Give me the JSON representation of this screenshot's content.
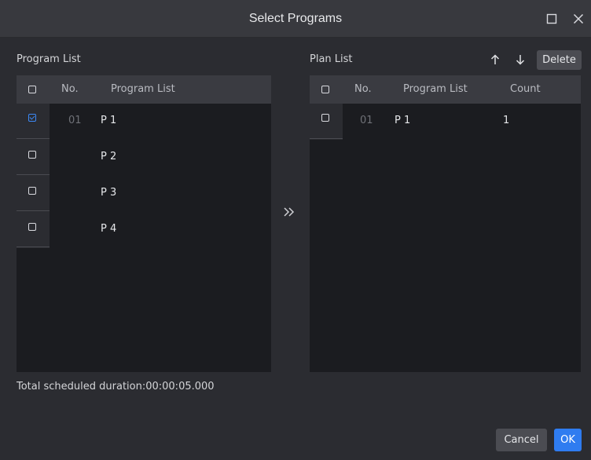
{
  "window": {
    "title": "Select Programs",
    "maximize_icon": "maximize-icon",
    "close_icon": "close-icon"
  },
  "program_list": {
    "label": "Program List",
    "columns": [
      "No.",
      "Program List"
    ],
    "rows": [
      {
        "no": "01",
        "name": "P 1",
        "checked": true
      },
      {
        "no": "",
        "name": "P 2",
        "checked": false
      },
      {
        "no": "",
        "name": "P 3",
        "checked": false
      },
      {
        "no": "",
        "name": "P 4",
        "checked": false
      }
    ]
  },
  "transfer_icon": "double-chevron-right-icon",
  "plan_list": {
    "label": "Plan List",
    "move_up_icon": "arrow-up-icon",
    "move_down_icon": "arrow-down-icon",
    "delete_label": "Delete",
    "columns": [
      "No.",
      "Program List",
      "Count"
    ],
    "rows": [
      {
        "no": "01",
        "name": "P 1",
        "count": "1",
        "checked": false
      }
    ]
  },
  "footer": {
    "duration": "Total scheduled duration:00:00:05.000",
    "cancel_label": "Cancel",
    "ok_label": "OK"
  },
  "colors": {
    "accent": "#2f7cf0",
    "background": "#2b2c31",
    "panel": "#1b1c20",
    "header": "#3a3b41"
  }
}
